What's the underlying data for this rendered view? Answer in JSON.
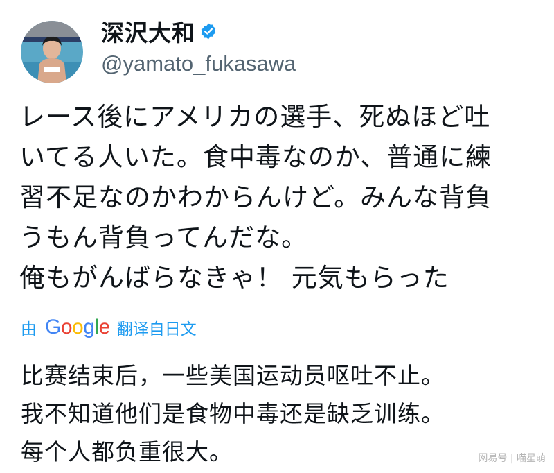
{
  "profile": {
    "display_name": "深沢大和",
    "handle": "@yamato_fukasawa",
    "verified": true,
    "verified_color": "#1d9bf0"
  },
  "tweet": {
    "lines": [
      "レース後にアメリカの選手、死ぬほど吐",
      "いてる人いた。食中毒なのか、普通に練",
      "習不足なのかわからんけど。みんな背負",
      "うもん背負ってんだな。",
      "俺もがんばらなきゃ！ 元気もらった"
    ]
  },
  "translation": {
    "by_label": "由",
    "provider_logo": "Google",
    "label": "翻译自日文",
    "lines": [
      "比赛结束后，一些美国运动员呕吐不止。",
      "我不知道他们是食物中毒还是缺乏训练。",
      "每个人都负重很大。"
    ]
  },
  "watermark": "网易号 | 喵星萌",
  "colors": {
    "link": "#1d9bf0",
    "text": "#0f1419",
    "secondary": "#536471"
  }
}
